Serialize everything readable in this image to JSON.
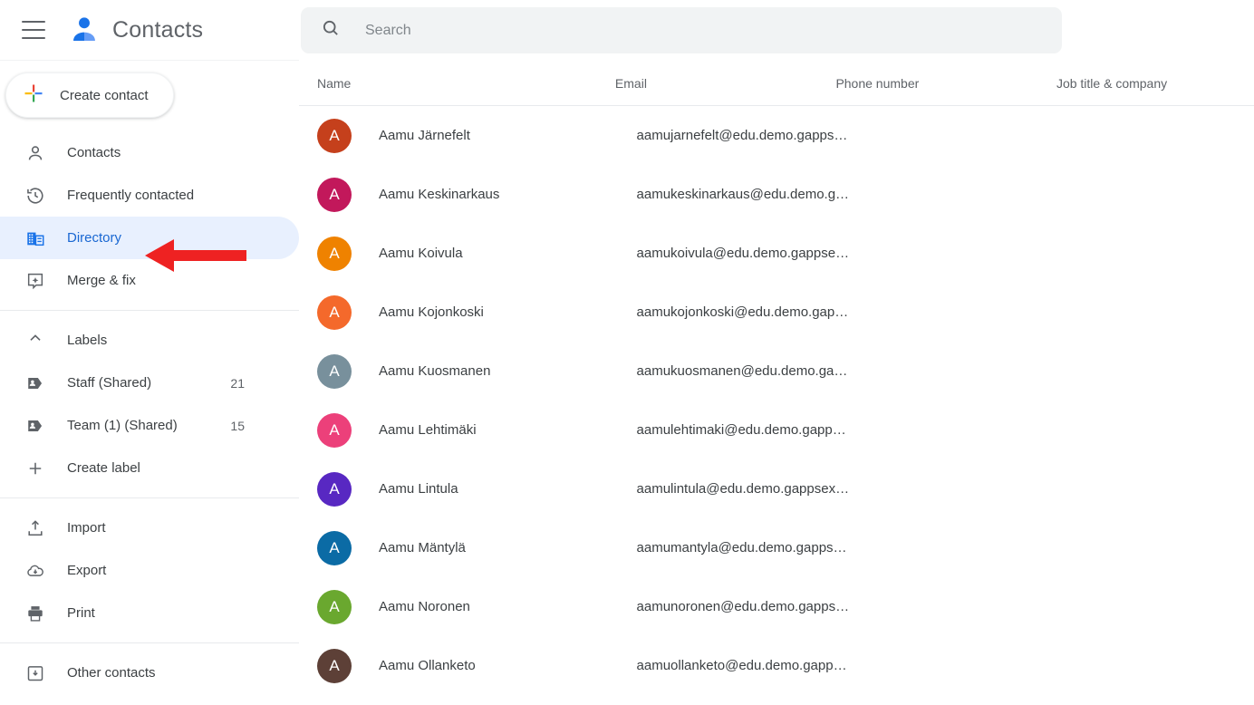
{
  "app": {
    "title": "Contacts",
    "menu_icon": "hamburger-menu-icon",
    "logo_icon": "contacts-person-logo-icon"
  },
  "create_button": {
    "label": "Create contact",
    "icon": "google-plus-icon"
  },
  "sidebar": {
    "nav": [
      {
        "label": "Contacts",
        "icon": "person-outline-icon",
        "active": false
      },
      {
        "label": "Frequently contacted",
        "icon": "history-clock-icon",
        "active": false
      },
      {
        "label": "Directory",
        "icon": "building-directory-icon",
        "active": true
      },
      {
        "label": "Merge & fix",
        "icon": "merge-sparkle-icon",
        "active": false
      }
    ],
    "labels_section": {
      "header": "Labels",
      "collapse_icon": "chevron-up-icon",
      "items": [
        {
          "label": "Staff (Shared)",
          "count": "21",
          "icon": "label-tag-icon"
        },
        {
          "label": "Team (1) (Shared)",
          "count": "15",
          "icon": "label-tag-icon"
        }
      ],
      "create_label": {
        "label": "Create label",
        "icon": "plus-icon"
      }
    },
    "actions": [
      {
        "label": "Import",
        "icon": "import-upload-icon"
      },
      {
        "label": "Export",
        "icon": "export-cloud-download-icon"
      },
      {
        "label": "Print",
        "icon": "printer-icon"
      }
    ],
    "other": [
      {
        "label": "Other contacts",
        "icon": "other-contacts-box-icon"
      }
    ]
  },
  "search": {
    "placeholder": "Search",
    "value": "",
    "icon": "search-icon"
  },
  "table": {
    "headers": {
      "name": "Name",
      "email": "Email",
      "phone": "Phone number",
      "job": "Job title & company"
    },
    "rows": [
      {
        "initial": "A",
        "color": "#c5401c",
        "name": "Aamu Järnefelt",
        "email": "aamujarnefelt@edu.demo.gapps…",
        "phone": "",
        "job": ""
      },
      {
        "initial": "A",
        "color": "#c2185b",
        "name": "Aamu Keskinarkaus",
        "email": "aamukeskinarkaus@edu.demo.g…",
        "phone": "",
        "job": ""
      },
      {
        "initial": "A",
        "color": "#ef8200",
        "name": "Aamu Koivula",
        "email": "aamukoivula@edu.demo.gappse…",
        "phone": "",
        "job": ""
      },
      {
        "initial": "A",
        "color": "#f4692b",
        "name": "Aamu Kojonkoski",
        "email": "aamukojonkoski@edu.demo.gap…",
        "phone": "",
        "job": ""
      },
      {
        "initial": "A",
        "color": "#78909c",
        "name": "Aamu Kuosmanen",
        "email": "aamukuosmanen@edu.demo.ga…",
        "phone": "",
        "job": ""
      },
      {
        "initial": "A",
        "color": "#ec407a",
        "name": "Aamu Lehtimäki",
        "email": "aamulehtimaki@edu.demo.gapp…",
        "phone": "",
        "job": ""
      },
      {
        "initial": "A",
        "color": "#5828c2",
        "name": "Aamu Lintula",
        "email": "aamulintula@edu.demo.gappsex…",
        "phone": "",
        "job": ""
      },
      {
        "initial": "A",
        "color": "#0b6ba5",
        "name": "Aamu Mäntylä",
        "email": "aamumantyla@edu.demo.gapps…",
        "phone": "",
        "job": ""
      },
      {
        "initial": "A",
        "color": "#6aa82f",
        "name": "Aamu Noronen",
        "email": "aamunoronen@edu.demo.gapps…",
        "phone": "",
        "job": ""
      },
      {
        "initial": "A",
        "color": "#5d4037",
        "name": "Aamu Ollanketo",
        "email": "aamuollanketo@edu.demo.gapp…",
        "phone": "",
        "job": ""
      }
    ]
  },
  "annotation": {
    "arrow_color": "#ee2222",
    "points_to": "Directory"
  }
}
